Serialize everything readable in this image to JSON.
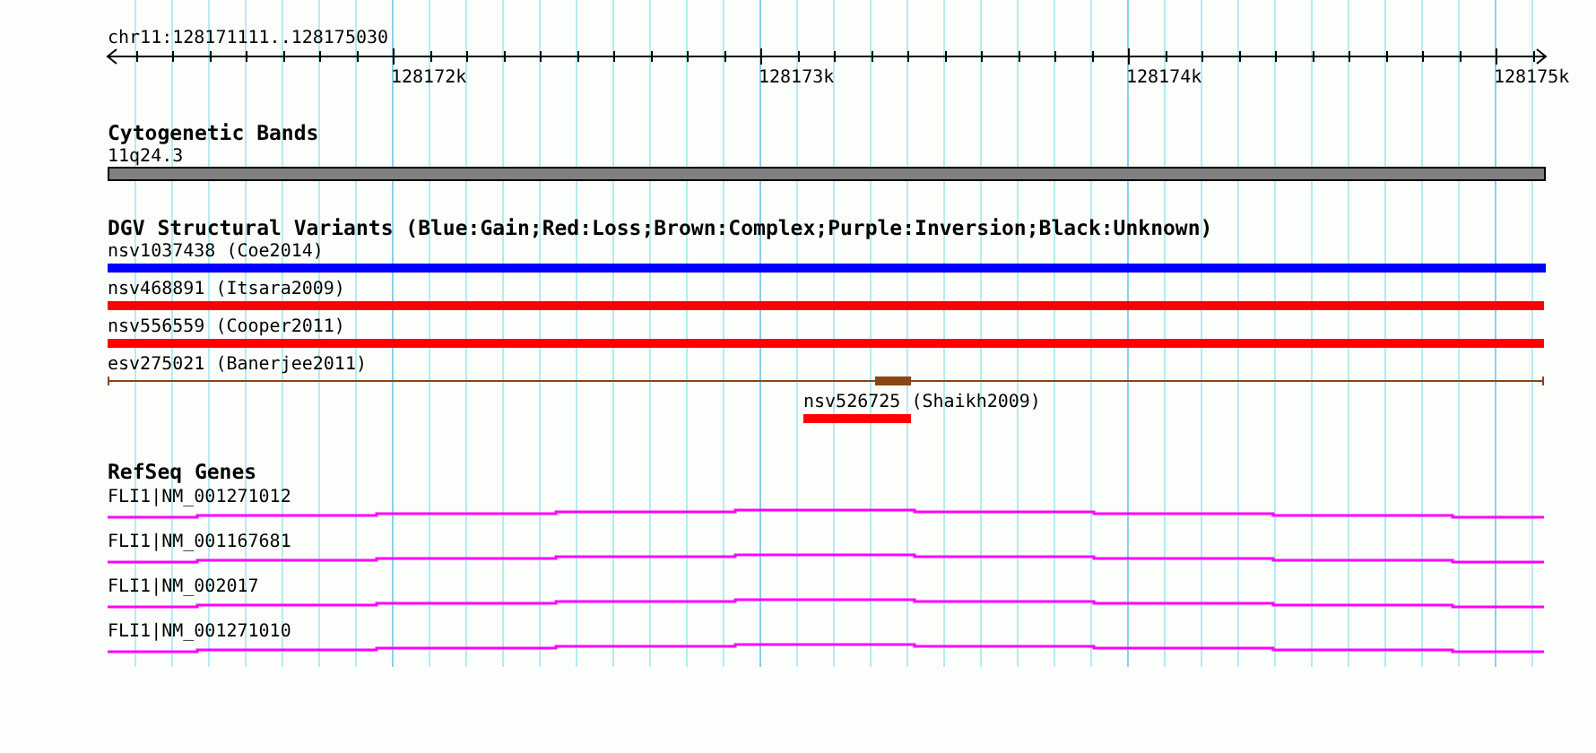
{
  "ruler": {
    "location": "chr11:128171111..128175030",
    "ticks": [
      "128172k",
      "128173k",
      "128174k",
      "128175k"
    ]
  },
  "tracks": [
    {
      "kind": "cytoband",
      "title": "Cytogenetic Bands",
      "features": [
        {
          "label": "11q24.3"
        }
      ]
    },
    {
      "kind": "variants",
      "title": "DGV Structural Variants (Blue:Gain;Red:Loss;Brown:Complex;Purple:Inversion;Black:Unknown)",
      "features": [
        {
          "kind": "bar",
          "label": "nsv1037438 (Coe2014)",
          "color": "#0000ff"
        },
        {
          "kind": "bar",
          "label": "nsv468891 (Itsara2009)",
          "color": "#ff0000"
        },
        {
          "kind": "bar",
          "label": "nsv556559 (Cooper2011)",
          "color": "#ff0000"
        },
        {
          "kind": "span",
          "label": "esv275021 (Banerjee2011)",
          "color": "#8b4513"
        },
        {
          "kind": "bar",
          "label": "nsv526725 (Shaikh2009)",
          "color": "#ff0000"
        }
      ]
    },
    {
      "kind": "genes",
      "title": "RefSeq Genes",
      "features": [
        {
          "label": "FLI1|NM_001271012"
        },
        {
          "label": "FLI1|NM_001167681"
        },
        {
          "label": "FLI1|NM_002017"
        },
        {
          "label": "FLI1|NM_001271010"
        }
      ]
    }
  ]
}
